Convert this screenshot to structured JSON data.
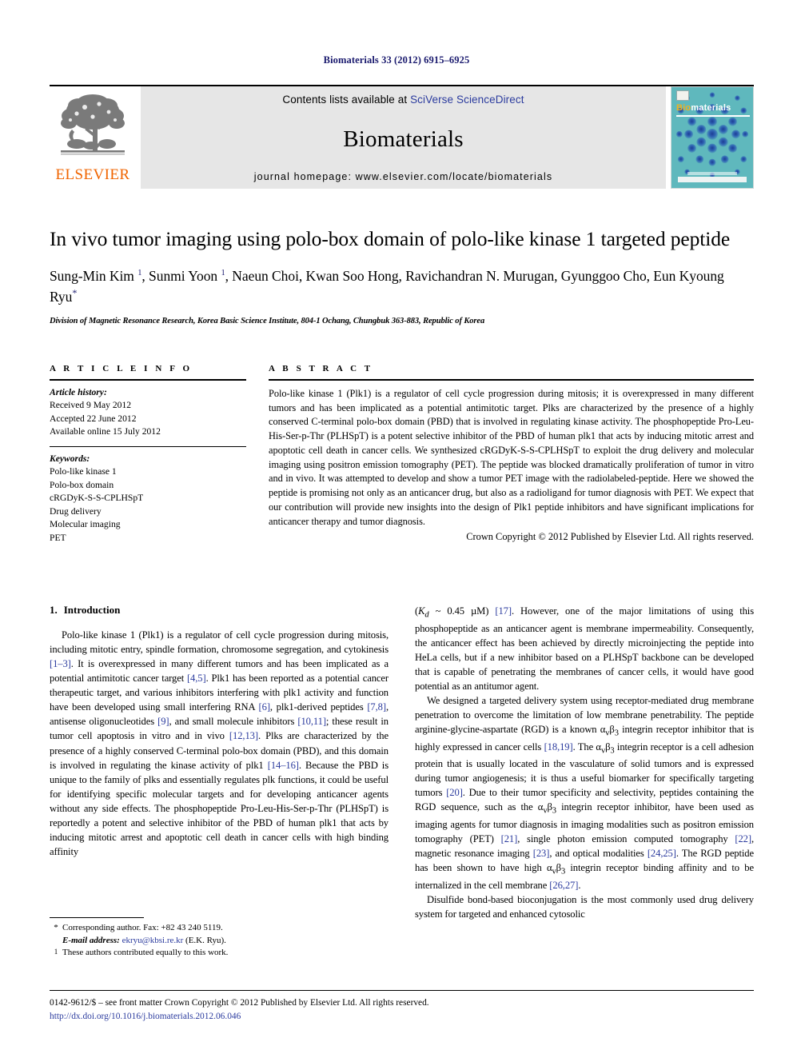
{
  "running_head": "Biomaterials 33 (2012) 6915–6925",
  "banner": {
    "publisher_name": "ELSEVIER",
    "contents_prefix": "Contents lists available at ",
    "sciencedirect_link": "SciVerse ScienceDirect",
    "journal_name": "Biomaterials",
    "homepage_line": "journal homepage: www.elsevier.com/locate/biomaterials",
    "cover": {
      "title_part1": "Bio",
      "title_part2": "materials"
    },
    "colors": {
      "elsevier_orange": "#f06400",
      "link_blue": "#2b3b9e",
      "cover_teal": "#5fb8bd",
      "cover_dots": "#2b4f9e"
    }
  },
  "article": {
    "title": "In vivo tumor imaging using polo-box domain of polo-like kinase 1 targeted peptide",
    "authors_html": "Sung-Min Kim <sup>1</sup>, Sunmi Yoon <sup>1</sup>, Naeun Choi, Kwan Soo Hong, Ravichandran N. Murugan, Gyunggoo Cho, Eun Kyoung Ryu<span class=\"star\">*</span>",
    "affiliation": "Division of Magnetic Resonance Research, Korea Basic Science Institute, 804-1 Ochang, Chungbuk 363-883, Republic of Korea"
  },
  "article_info": {
    "heading": "A R T I C L E   I N F O",
    "history_label": "Article history:",
    "history": [
      "Received 9 May 2012",
      "Accepted 22 June 2012",
      "Available online 15 July 2012"
    ],
    "keywords_label": "Keywords:",
    "keywords": [
      "Polo-like kinase 1",
      "Polo-box domain",
      "cRGDyK-S-S-CPLHSpT",
      "Drug delivery",
      "Molecular imaging",
      "PET"
    ]
  },
  "abstract": {
    "heading": "A B S T R A C T",
    "text": "Polo-like kinase 1 (Plk1) is a regulator of cell cycle progression during mitosis; it is overexpressed in many different tumors and has been implicated as a potential antimitotic target. Plks are characterized by the presence of a highly conserved C-terminal polo-box domain (PBD) that is involved in regulating kinase activity. The phosphopeptide Pro-Leu-His-Ser-p-Thr (PLHSpT) is a potent selective inhibitor of the PBD of human plk1 that acts by inducing mitotic arrest and apoptotic cell death in cancer cells. We synthesized cRGDyK-S-S-CPLHSpT to exploit the drug delivery and molecular imaging using positron emission tomography (PET). The peptide was blocked dramatically proliferation of tumor in vitro and in vivo. It was attempted to develop and show a tumor PET image with the radiolabeled-peptide. Here we showed the peptide is promising not only as an anticancer drug, but also as a radioligand for tumor diagnosis with PET. We expect that our contribution will provide new insights into the design of Plk1 peptide inhibitors and have significant implications for anticancer therapy and tumor diagnosis.",
    "copyright": "Crown Copyright © 2012 Published by Elsevier Ltd. All rights reserved."
  },
  "introduction": {
    "number": "1.",
    "title": "Introduction",
    "left_paragraph_html": "Polo-like kinase 1 (Plk1) is a regulator of cell cycle progression during mitosis, including mitotic entry, spindle formation, chromosome segregation, and cytokinesis <span class=\"ref\">[1&ndash;3]</span>. It is overexpressed in many different tumors and has been implicated as a potential antimitotic cancer target <span class=\"ref\">[4,5]</span>. Plk1 has been reported as a potential cancer therapeutic target, and various inhibitors interfering with plk1 activity and function have been developed using small interfering RNA <span class=\"ref\">[6]</span>, plk1-derived peptides <span class=\"ref\">[7,8]</span>, antisense oligonucleotides <span class=\"ref\">[9]</span>, and small molecule inhibitors <span class=\"ref\">[10,11]</span>; these result in tumor cell apoptosis in vitro and in vivo <span class=\"ref\">[12,13]</span>. Plks are characterized by the presence of a highly conserved C-terminal polo-box domain (PBD), and this domain is involved in regulating the kinase activity of plk1 <span class=\"ref\">[14&ndash;16]</span>. Because the PBD is unique to the family of plks and essentially regulates plk functions, it could be useful for identifying specific molecular targets and for developing anticancer agents without any side effects. The phosphopeptide Pro-Leu-His-Ser-p-Thr (PLHSpT) is reportedly a potent and selective inhibitor of the PBD of human plk1 that acts by inducing mitotic arrest and apoptotic cell death in cancer cells with high binding affinity",
    "right_paragraph1_html": "(<i>K<sub>d</sub></i> ~ 0.45 &micro;M) <span class=\"ref\">[17]</span>. However, one of the major limitations of using this phosphopeptide as an anticancer agent is membrane impermeability. Consequently, the anticancer effect has been achieved by directly microinjecting the peptide into HeLa cells, but if a new inhibitor based on a PLHSpT backbone can be developed that is capable of penetrating the membranes of cancer cells, it would have good potential as an antitumor agent.",
    "right_paragraph2_html": "We designed a targeted delivery system using receptor-mediated drug membrane penetration to overcome the limitation of low membrane penetrability. The peptide arginine-glycine-aspartate (RGD) is a known &alpha;<sub>v</sub>&beta;<sub>3</sub> integrin receptor inhibitor that is highly expressed in cancer cells <span class=\"ref\">[18,19]</span>. The &alpha;<sub>v</sub>&beta;<sub>3</sub> integrin receptor is a cell adhesion protein that is usually located in the vasculature of solid tumors and is expressed during tumor angiogenesis; it is thus a useful biomarker for specifically targeting tumors <span class=\"ref\">[20]</span>. Due to their tumor specificity and selectivity, peptides containing the RGD sequence, such as the &alpha;<sub>v</sub>&beta;<sub>3</sub> integrin receptor inhibitor, have been used as imaging agents for tumor diagnosis in imaging modalities such as positron emission tomography (PET) <span class=\"ref\">[21]</span>, single photon emission computed tomography <span class=\"ref\">[22]</span>, magnetic resonance imaging <span class=\"ref\">[23]</span>, and optical modalities <span class=\"ref\">[24,25]</span>. The RGD peptide has been shown to have high &alpha;<sub>v</sub>&beta;<sub>3</sub> integrin receptor binding affinity and to be internalized in the cell membrane <span class=\"ref\">[26,27]</span>.",
    "right_paragraph3_html": "Disulfide bond-based bioconjugation is the most commonly used drug delivery system for targeted and enhanced cytosolic"
  },
  "footnotes": {
    "corresponding_mark": "*",
    "corresponding_text": "Corresponding author. Fax: +82 43 240 5119.",
    "email_label": "E-mail address:",
    "email": "ekryu@kbsi.re.kr",
    "email_owner": "(E.K. Ryu).",
    "equal_mark": "1",
    "equal_text": "These authors contributed equally to this work."
  },
  "footer": {
    "issn_line": "0142-9612/$ – see front matter Crown Copyright © 2012 Published by Elsevier Ltd. All rights reserved.",
    "doi": "http://dx.doi.org/10.1016/j.biomaterials.2012.06.046"
  }
}
